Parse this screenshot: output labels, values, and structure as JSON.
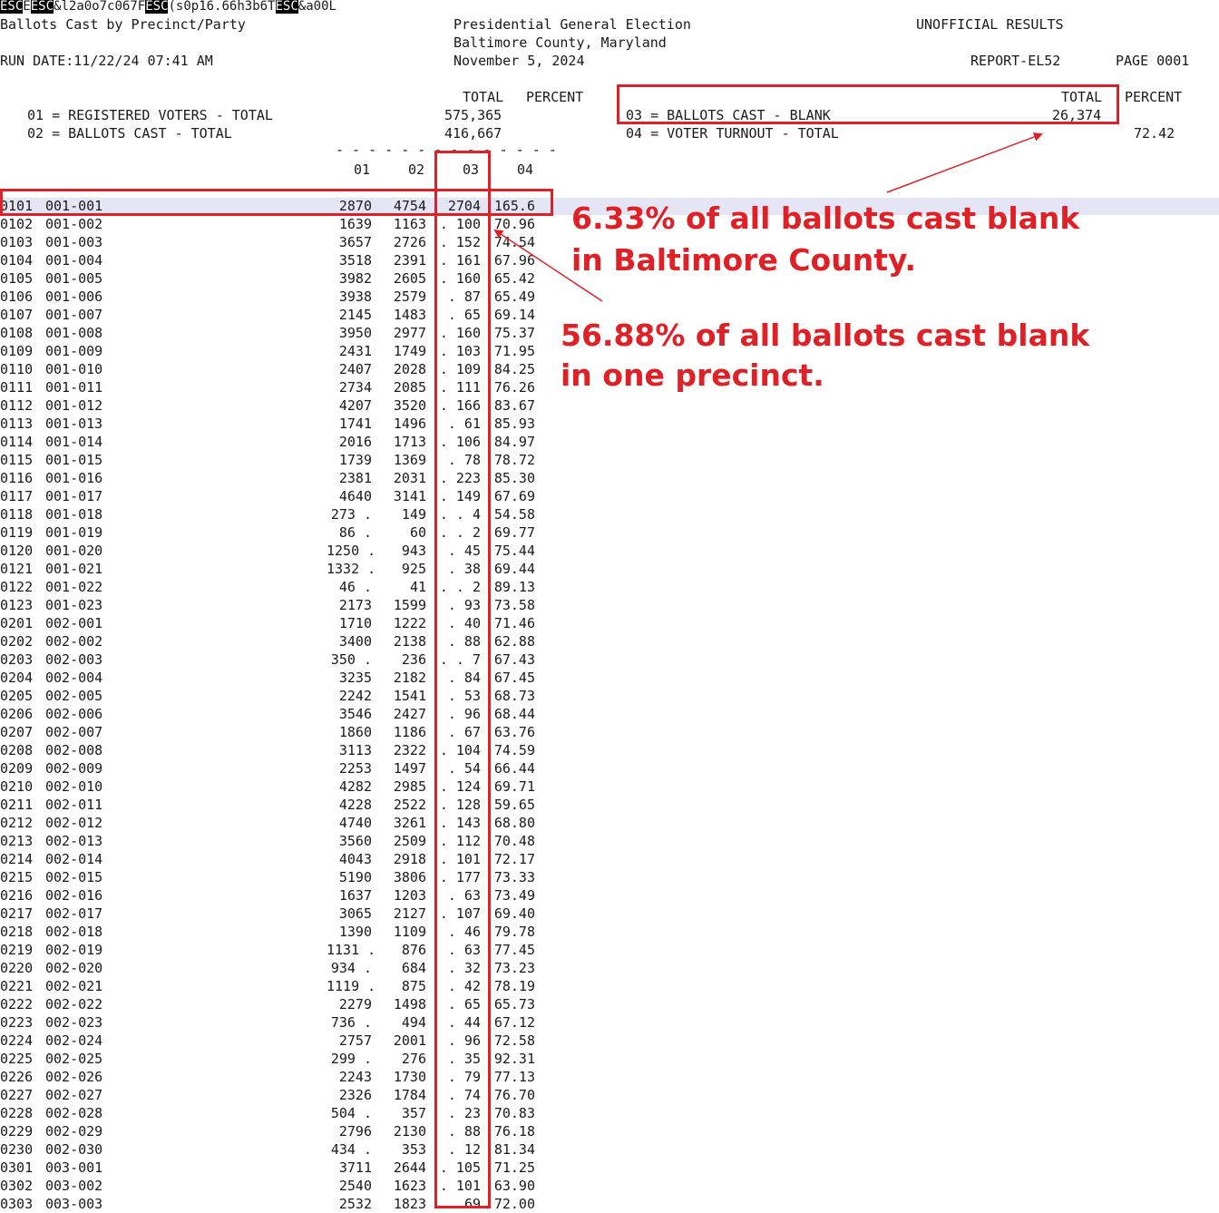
{
  "printer_codes": {
    "segments": [
      {
        "text": "ESC",
        "inv": true
      },
      {
        "text": "E",
        "inv": false
      },
      {
        "text": "ESC",
        "inv": true
      },
      {
        "text": "&l2a0o7c067F",
        "inv": false
      },
      {
        "text": "ESC",
        "inv": true
      },
      {
        "text": "(s0p16.66h3b6T",
        "inv": false
      },
      {
        "text": "ESC",
        "inv": true
      },
      {
        "text": "&a00L",
        "inv": false
      }
    ]
  },
  "header": {
    "report_title": "Ballots Cast by Precinct/Party",
    "election": "Presidential General Election",
    "status": "UNOFFICIAL RESULTS",
    "county": "Baltimore County, Maryland",
    "run_date": "RUN DATE:11/22/24 07:41 AM",
    "election_date": "November 5, 2024",
    "report_id": "REPORT-EL52",
    "page": "PAGE 0001"
  },
  "summary": {
    "total_label": "TOTAL",
    "percent_label": "PERCENT",
    "right_total_label": "TOTAL",
    "right_percent_label": "PERCENT",
    "line01": "01 = REGISTERED VOTERS - TOTAL",
    "line01_value": "575,365",
    "line02": "02 = BALLOTS CAST - TOTAL",
    "line02_value": "416,667",
    "line03": "03 = BALLOTS CAST - BLANK",
    "line03_value": "26,374",
    "line04": "04 = VOTER TURNOUT - TOTAL",
    "line04_value": "72.42"
  },
  "columns": {
    "c01": "01",
    "c02": "02",
    "c03": "03",
    "c04": "04",
    "dashes": "- - - - - - - - - - - - - -"
  },
  "annotations": {
    "county_line1": "6.33% of all ballots cast blank",
    "county_line2": "in Baltimore County.",
    "precinct_line1": "56.88% of all ballots cast blank",
    "precinct_line2": "in one precinct."
  },
  "colors": {
    "annotation": "#e02027",
    "highlight_row": "#e4e6f6"
  },
  "rows": [
    {
      "id": "0101",
      "precinct": "001-001",
      "c01": "2870",
      "c02": "4754",
      "c03": "2704",
      "c04": "165.6"
    },
    {
      "id": "0102",
      "precinct": "001-002",
      "c01": "1639",
      "c02": "1163",
      "c03": ". 100",
      "c04": "70.96"
    },
    {
      "id": "0103",
      "precinct": "001-003",
      "c01": "3657",
      "c02": "2726",
      "c03": ". 152",
      "c04": "74.54"
    },
    {
      "id": "0104",
      "precinct": "001-004",
      "c01": "3518",
      "c02": "2391",
      "c03": ". 161",
      "c04": "67.96"
    },
    {
      "id": "0105",
      "precinct": "001-005",
      "c01": "3982",
      "c02": "2605",
      "c03": ". 160",
      "c04": "65.42"
    },
    {
      "id": "0106",
      "precinct": "001-006",
      "c01": "3938",
      "c02": "2579",
      "c03": ". 87",
      "c04": "65.49"
    },
    {
      "id": "0107",
      "precinct": "001-007",
      "c01": "2145",
      "c02": "1483",
      "c03": ". 65",
      "c04": "69.14"
    },
    {
      "id": "0108",
      "precinct": "001-008",
      "c01": "3950",
      "c02": "2977",
      "c03": ". 160",
      "c04": "75.37"
    },
    {
      "id": "0109",
      "precinct": "001-009",
      "c01": "2431",
      "c02": "1749",
      "c03": ". 103",
      "c04": "71.95"
    },
    {
      "id": "0110",
      "precinct": "001-010",
      "c01": "2407",
      "c02": "2028",
      "c03": ". 109",
      "c04": "84.25"
    },
    {
      "id": "0111",
      "precinct": "001-011",
      "c01": "2734",
      "c02": "2085",
      "c03": ". 111",
      "c04": "76.26"
    },
    {
      "id": "0112",
      "precinct": "001-012",
      "c01": "4207",
      "c02": "3520",
      "c03": ". 166",
      "c04": "83.67"
    },
    {
      "id": "0113",
      "precinct": "001-013",
      "c01": "1741",
      "c02": "1496",
      "c03": ". 61",
      "c04": "85.93"
    },
    {
      "id": "0114",
      "precinct": "001-014",
      "c01": "2016",
      "c02": "1713",
      "c03": ". 106",
      "c04": "84.97"
    },
    {
      "id": "0115",
      "precinct": "001-015",
      "c01": "1739",
      "c02": "1369",
      "c03": ". 78",
      "c04": "78.72"
    },
    {
      "id": "0116",
      "precinct": "001-016",
      "c01": "2381",
      "c02": "2031",
      "c03": ". 223",
      "c04": "85.30"
    },
    {
      "id": "0117",
      "precinct": "001-017",
      "c01": "4640",
      "c02": "3141",
      "c03": ". 149",
      "c04": "67.69"
    },
    {
      "id": "0118",
      "precinct": "001-018",
      "c01": "273 .",
      "c02": "149",
      "c03": ". . 4",
      "c04": "54.58"
    },
    {
      "id": "0119",
      "precinct": "001-019",
      "c01": "86 .",
      "c02": "60",
      "c03": ". . 2",
      "c04": "69.77"
    },
    {
      "id": "0120",
      "precinct": "001-020",
      "c01": "1250 .",
      "c02": "943",
      "c03": ". 45",
      "c04": "75.44"
    },
    {
      "id": "0121",
      "precinct": "001-021",
      "c01": "1332 .",
      "c02": "925",
      "c03": ". 38",
      "c04": "69.44"
    },
    {
      "id": "0122",
      "precinct": "001-022",
      "c01": "46 .",
      "c02": "41",
      "c03": ". . 2",
      "c04": "89.13"
    },
    {
      "id": "0123",
      "precinct": "001-023",
      "c01": "2173",
      "c02": "1599",
      "c03": ". 93",
      "c04": "73.58"
    },
    {
      "id": "0201",
      "precinct": "002-001",
      "c01": "1710",
      "c02": "1222",
      "c03": ". 40",
      "c04": "71.46"
    },
    {
      "id": "0202",
      "precinct": "002-002",
      "c01": "3400",
      "c02": "2138",
      "c03": ". 88",
      "c04": "62.88"
    },
    {
      "id": "0203",
      "precinct": "002-003",
      "c01": "350 .",
      "c02": "236",
      "c03": ". . 7",
      "c04": "67.43"
    },
    {
      "id": "0204",
      "precinct": "002-004",
      "c01": "3235",
      "c02": "2182",
      "c03": ". 84",
      "c04": "67.45"
    },
    {
      "id": "0205",
      "precinct": "002-005",
      "c01": "2242",
      "c02": "1541",
      "c03": ". 53",
      "c04": "68.73"
    },
    {
      "id": "0206",
      "precinct": "002-006",
      "c01": "3546",
      "c02": "2427",
      "c03": ". 96",
      "c04": "68.44"
    },
    {
      "id": "0207",
      "precinct": "002-007",
      "c01": "1860",
      "c02": "1186",
      "c03": ". 67",
      "c04": "63.76"
    },
    {
      "id": "0208",
      "precinct": "002-008",
      "c01": "3113",
      "c02": "2322",
      "c03": ". 104",
      "c04": "74.59"
    },
    {
      "id": "0209",
      "precinct": "002-009",
      "c01": "2253",
      "c02": "1497",
      "c03": ". 54",
      "c04": "66.44"
    },
    {
      "id": "0210",
      "precinct": "002-010",
      "c01": "4282",
      "c02": "2985",
      "c03": ". 124",
      "c04": "69.71"
    },
    {
      "id": "0211",
      "precinct": "002-011",
      "c01": "4228",
      "c02": "2522",
      "c03": ". 128",
      "c04": "59.65"
    },
    {
      "id": "0212",
      "precinct": "002-012",
      "c01": "4740",
      "c02": "3261",
      "c03": ". 143",
      "c04": "68.80"
    },
    {
      "id": "0213",
      "precinct": "002-013",
      "c01": "3560",
      "c02": "2509",
      "c03": ". 112",
      "c04": "70.48"
    },
    {
      "id": "0214",
      "precinct": "002-014",
      "c01": "4043",
      "c02": "2918",
      "c03": ". 101",
      "c04": "72.17"
    },
    {
      "id": "0215",
      "precinct": "002-015",
      "c01": "5190",
      "c02": "3806",
      "c03": ". 177",
      "c04": "73.33"
    },
    {
      "id": "0216",
      "precinct": "002-016",
      "c01": "1637",
      "c02": "1203",
      "c03": ". 63",
      "c04": "73.49"
    },
    {
      "id": "0217",
      "precinct": "002-017",
      "c01": "3065",
      "c02": "2127",
      "c03": ". 107",
      "c04": "69.40"
    },
    {
      "id": "0218",
      "precinct": "002-018",
      "c01": "1390",
      "c02": "1109",
      "c03": ". 46",
      "c04": "79.78"
    },
    {
      "id": "0219",
      "precinct": "002-019",
      "c01": "1131 .",
      "c02": "876",
      "c03": ". 63",
      "c04": "77.45"
    },
    {
      "id": "0220",
      "precinct": "002-020",
      "c01": "934 .",
      "c02": "684",
      "c03": ". 32",
      "c04": "73.23"
    },
    {
      "id": "0221",
      "precinct": "002-021",
      "c01": "1119 .",
      "c02": "875",
      "c03": ". 42",
      "c04": "78.19"
    },
    {
      "id": "0222",
      "precinct": "002-022",
      "c01": "2279",
      "c02": "1498",
      "c03": ". 65",
      "c04": "65.73"
    },
    {
      "id": "0223",
      "precinct": "002-023",
      "c01": "736 .",
      "c02": "494",
      "c03": ". 44",
      "c04": "67.12"
    },
    {
      "id": "0224",
      "precinct": "002-024",
      "c01": "2757",
      "c02": "2001",
      "c03": ". 96",
      "c04": "72.58"
    },
    {
      "id": "0225",
      "precinct": "002-025",
      "c01": "299 .",
      "c02": "276",
      "c03": ". 35",
      "c04": "92.31"
    },
    {
      "id": "0226",
      "precinct": "002-026",
      "c01": "2243",
      "c02": "1730",
      "c03": ". 79",
      "c04": "77.13"
    },
    {
      "id": "0227",
      "precinct": "002-027",
      "c01": "2326",
      "c02": "1784",
      "c03": ". 74",
      "c04": "76.70"
    },
    {
      "id": "0228",
      "precinct": "002-028",
      "c01": "504 .",
      "c02": "357",
      "c03": ". 23",
      "c04": "70.83"
    },
    {
      "id": "0229",
      "precinct": "002-029",
      "c01": "2796",
      "c02": "2130",
      "c03": ". 88",
      "c04": "76.18"
    },
    {
      "id": "0230",
      "precinct": "002-030",
      "c01": "434 .",
      "c02": "353",
      "c03": ". 12",
      "c04": "81.34"
    },
    {
      "id": "0301",
      "precinct": "003-001",
      "c01": "3711",
      "c02": "2644",
      "c03": ". 105",
      "c04": "71.25"
    },
    {
      "id": "0302",
      "precinct": "003-002",
      "c01": "2540",
      "c02": "1623",
      "c03": ". 101",
      "c04": "63.90"
    },
    {
      "id": "0303",
      "precinct": "003-003",
      "c01": "2532",
      "c02": "1823",
      "c03": "69",
      "c04": "72.00"
    }
  ]
}
